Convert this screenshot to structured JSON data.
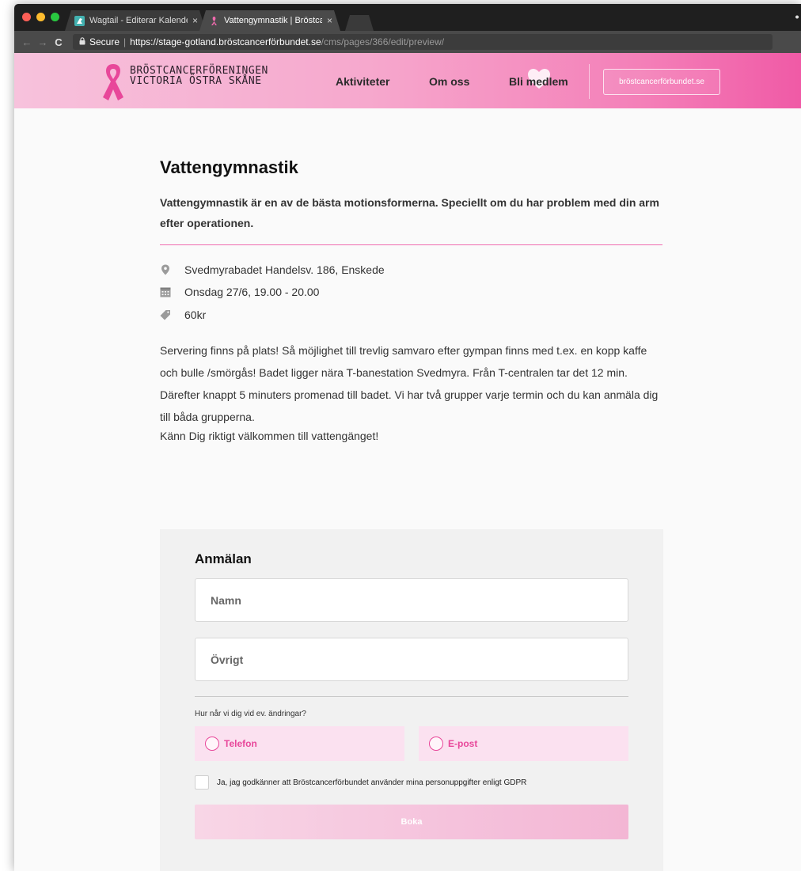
{
  "browser": {
    "tabs": [
      {
        "title": "Wagtail - Editerar Kalenderhän",
        "close": "×"
      },
      {
        "title": "Vattengymnastik | Bröstcancer",
        "close": "×"
      }
    ],
    "nav": {
      "back": "←",
      "forward": "→",
      "reload": "C"
    },
    "address": {
      "lock": "🔒",
      "secure_label": "Secure",
      "separator": "|",
      "scheme": "https://",
      "host": "stage-gotland.bröstcancerförbundet.se",
      "path": "/cms/pages/366/edit/preview/"
    },
    "star": "☆",
    "menu": "⋮",
    "incognito": "ꔷ"
  },
  "site": {
    "logo_line1": "BRÖSTCANCERFÖRENINGEN",
    "logo_line2": "VICTORIA ÖSTRA SKÅNE",
    "nav": [
      "Aktiviteter",
      "Om oss",
      "Bli medlem"
    ],
    "cta": "bröstcancerförbundet.se",
    "brand_color": "#f06aae"
  },
  "event": {
    "title": "Vattengymnastik",
    "lead": "Vattengymnastik är en av de bästa motionsformerna. Speciellt om du har problem med din arm efter operationen.",
    "location": "Svedmyrabadet Handelsv. 186, Enskede",
    "date": "Onsdag 27/6, 19.00 - 20.00",
    "price": "60kr",
    "body": "Servering finns på plats! Så möjlighet till trevlig samvaro efter gympan finns med t.ex. en kopp kaffe och bulle /smörgås! Badet ligger nära T-banestation Svedmyra. Från T-centralen tar det 12 min. Därefter knappt 5 minuters promenad till badet. Vi har två grupper varje termin och du kan anmäla dig till båda grupperna.",
    "welcome": "Känn Dig riktigt välkommen till vattengänget!"
  },
  "form": {
    "title": "Anmälan",
    "name_placeholder": "Namn",
    "other_placeholder": "Övrigt",
    "question": "Hur når vi dig vid ev. ändringar?",
    "options": [
      "Telefon",
      "E-post"
    ],
    "gdpr": "Ja, jag godkänner att Bröstcancerförbundet använder mina personuppgifter enligt GDPR",
    "submit": "Boka"
  }
}
